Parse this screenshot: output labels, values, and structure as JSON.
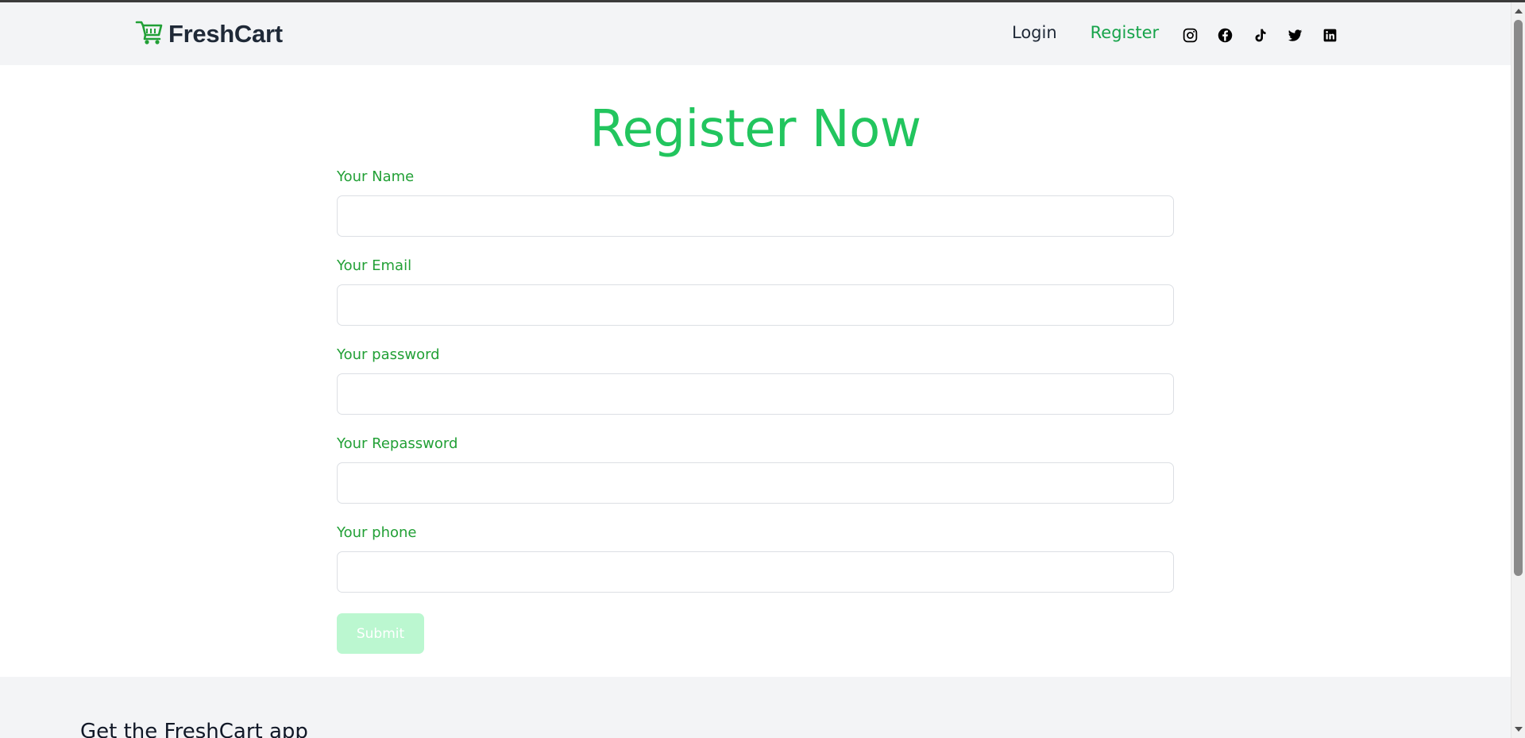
{
  "header": {
    "brand": "FreshCart",
    "brand_icon": "shopping-cart-icon",
    "nav": [
      {
        "label": "Login",
        "active": false
      },
      {
        "label": "Register",
        "active": true
      }
    ],
    "socials": [
      "instagram-icon",
      "facebook-icon",
      "tiktok-icon",
      "twitter-icon",
      "linkedin-icon"
    ]
  },
  "main": {
    "title": "Register Now",
    "fields": [
      {
        "label": "Your Name",
        "value": "",
        "placeholder": ""
      },
      {
        "label": "Your Email",
        "value": "",
        "placeholder": ""
      },
      {
        "label": "Your password",
        "value": "",
        "placeholder": ""
      },
      {
        "label": "Your Repassword",
        "value": "",
        "placeholder": ""
      },
      {
        "label": "Your phone",
        "value": "",
        "placeholder": ""
      }
    ],
    "submit_label": "Submit",
    "submit_state": "disabled"
  },
  "footer": {
    "title": "Get the FreshCart app"
  },
  "colors": {
    "accent": "#22c55e",
    "label": "#22a036",
    "nav_bg": "#f3f4f6",
    "submit_bg": "#bbf7d0",
    "brand_text": "#1f2937"
  }
}
